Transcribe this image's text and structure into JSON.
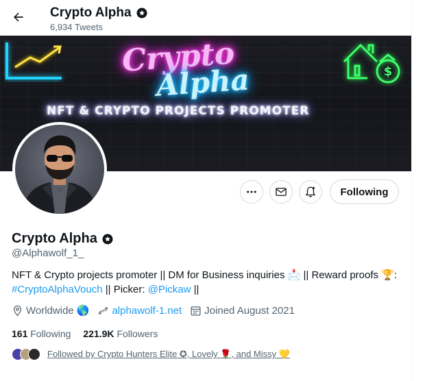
{
  "header": {
    "name": "Crypto Alpha",
    "tweet_count": "6,934 Tweets"
  },
  "banner": {
    "line1": "Crypto",
    "line2": "Alpha",
    "tagline": "NFT & CRYPTO PROJECTS PROMOTER"
  },
  "actions": {
    "follow_label": "Following"
  },
  "profile": {
    "name": "Crypto Alpha",
    "handle": "@Alphawolf_1_",
    "bio_part1": "NFT & Crypto projects promoter || DM for Business inquiries ",
    "bio_emoji1": "📩",
    "bio_part2": " || Reward proofs ",
    "bio_emoji2": "🏆",
    "bio_part3": ":",
    "bio_hashtag": "#CryptoAlphaVouch",
    "bio_part4": " || Picker: ",
    "bio_mention": "@Pickaw",
    "bio_part5": " ||",
    "location": "Worldwide",
    "location_emoji": "🌎",
    "website": "alphawolf-1.net",
    "joined": "Joined August 2021"
  },
  "stats": {
    "following_count": "161",
    "following_label": "Following",
    "followers_count": "221.9K",
    "followers_label": "Followers"
  },
  "followed_by": {
    "text": "Followed by Crypto Hunters Elite ✪, Lovely 🌹, and Missy 💛"
  },
  "colors": {
    "link": "#1d9bf0",
    "secondary_text": "#536471"
  }
}
